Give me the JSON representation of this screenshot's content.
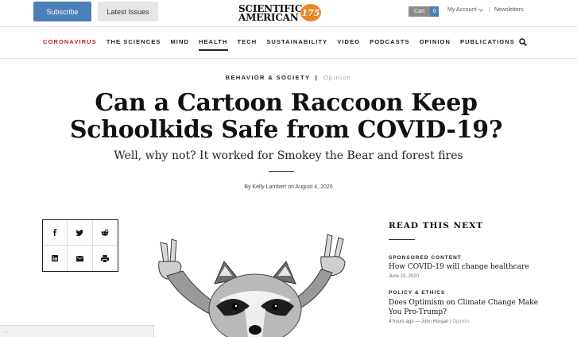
{
  "header": {
    "subscribe_label": "Subscribe",
    "latest_issues_label": "Latest Issues",
    "logo_line1": "SCIENTIFIC",
    "logo_line2": "AMERICAN",
    "logo_badge": "175",
    "cart_label": "Cart",
    "cart_count": "0",
    "account_label": "My Account",
    "separator": "|",
    "newsletters_label": "Newsletters"
  },
  "nav": {
    "items": [
      {
        "label": "CORONAVIRUS"
      },
      {
        "label": "THE SCIENCES"
      },
      {
        "label": "MIND"
      },
      {
        "label": "HEALTH"
      },
      {
        "label": "TECH"
      },
      {
        "label": "SUSTAINABILITY"
      },
      {
        "label": "VIDEO"
      },
      {
        "label": "PODCASTS"
      },
      {
        "label": "OPINION"
      },
      {
        "label": "PUBLICATIONS"
      }
    ]
  },
  "article": {
    "kicker_section": "BEHAVIOR & SOCIETY",
    "kicker_bar": "|",
    "kicker_type": "Opinion",
    "headline_line1": "Can a Cartoon Raccoon Keep",
    "headline_line2": "Schoolkids Safe from COVID-19?",
    "dek": "Well, why not? It worked for Smokey the Bear and forest fires",
    "byline": "By Kelly Lambert on August 4, 2020"
  },
  "share": {
    "icons": [
      "facebook-icon",
      "twitter-icon",
      "reddit-icon",
      "linkedin-icon",
      "email-icon",
      "print-icon"
    ]
  },
  "read_next": {
    "title": "READ THIS NEXT",
    "items": [
      {
        "category": "SPONSORED CONTENT",
        "headline": "How COVID-19 will change healthcare",
        "meta": "June 22, 2020"
      },
      {
        "category": "POLICY & ETHICS",
        "headline_line1": "Does Optimism on Climate Change Make",
        "headline_line2": "You Pro-Trump?",
        "meta": "4 hours ago — John Horgan |",
        "meta_type": "Opinion"
      }
    ]
  },
  "status_bar": {
    "text": "..."
  },
  "colors": {
    "accent_blue": "#4a7fb7",
    "coronavirus_red": "#b5271d",
    "logo_orange": "#e8862a"
  }
}
